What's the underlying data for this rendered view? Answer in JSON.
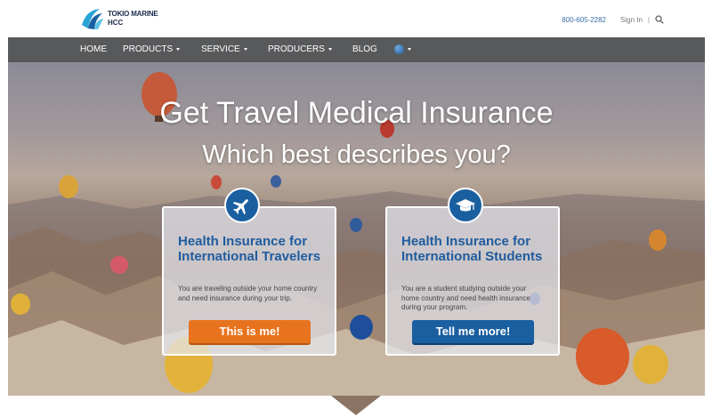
{
  "header": {
    "logo_line1": "TOKIO MARINE",
    "logo_line2": "HCC",
    "phone": "800-605-2282",
    "signin_label": "Sign In",
    "separator": "|",
    "search_icon": "search-icon"
  },
  "nav": {
    "items": [
      {
        "label": "HOME",
        "has_caret": false
      },
      {
        "label": "PRODUCTS",
        "has_caret": true
      },
      {
        "label": "SERVICE",
        "has_caret": true
      },
      {
        "label": "PRODUCERS",
        "has_caret": true
      },
      {
        "label": "BLOG",
        "has_caret": false
      }
    ],
    "language_icon": "globe-icon",
    "bar_color": "#58595b"
  },
  "hero": {
    "title": "Get Travel Medical Insurance",
    "subtitle": "Which best describes you?"
  },
  "cards": [
    {
      "icon": "airplane-icon",
      "title": "Health Insurance for International Travelers",
      "text": "You are traveling outside your home country and need insurance during your trip.",
      "button_label": "This is me!",
      "button_color": "#e8731e"
    },
    {
      "icon": "graduation-cap-icon",
      "title": "Health Insurance for International Students",
      "text": "You are a student studying outside your home country and need health insurance during your program.",
      "button_label": "Tell me more!",
      "button_color": "#1a5fa0"
    }
  ],
  "colors": {
    "brand_blue": "#1a5fa0",
    "accent_orange": "#e8731e",
    "title_blue": "#1f5c9e"
  }
}
